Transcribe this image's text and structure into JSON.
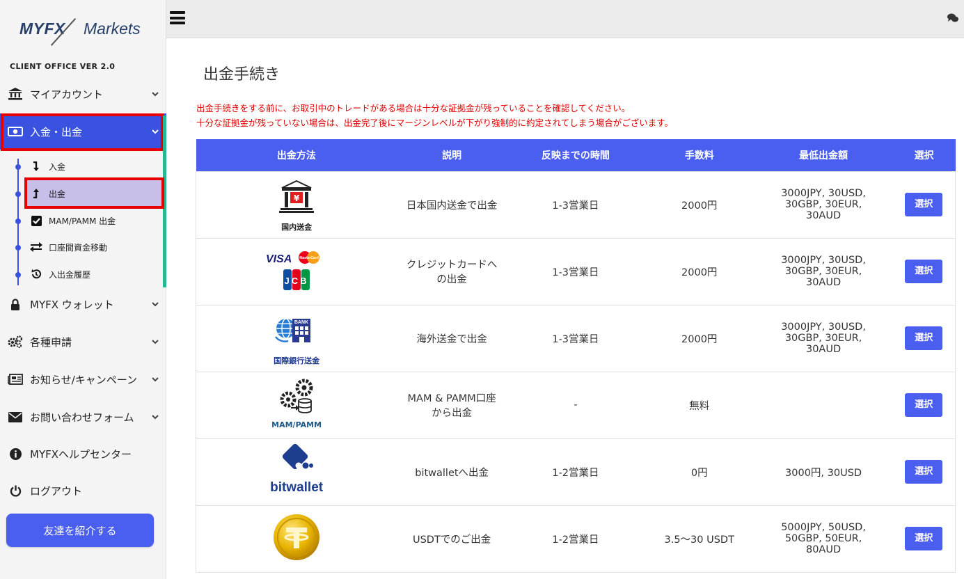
{
  "brand": {
    "logo_left": "MYFX",
    "logo_right": "Markets",
    "version_label": "CLIENT OFFICE VER 2.0"
  },
  "sidebar": {
    "items": [
      {
        "label": "マイアカウント",
        "icon": "bank-icon"
      },
      {
        "label": "入金・出金",
        "icon": "money-icon"
      },
      {
        "label": "MYFX ウォレット",
        "icon": "lock-icon"
      },
      {
        "label": "各種申請",
        "icon": "gears-icon"
      },
      {
        "label": "お知らせ/キャンペーン",
        "icon": "newspaper-icon"
      },
      {
        "label": "お問い合わせフォーム",
        "icon": "envelope-icon"
      },
      {
        "label": "MYFXヘルプセンター",
        "icon": "info-icon"
      },
      {
        "label": "ログアウト",
        "icon": "power-icon"
      }
    ],
    "sub_items": [
      {
        "label": "入金",
        "icon": "arrow-down-icon"
      },
      {
        "label": "出金",
        "icon": "arrow-up-icon"
      },
      {
        "label": "MAM/PAMM 出金",
        "icon": "checkbox-icon"
      },
      {
        "label": "口座間資金移動",
        "icon": "transfer-icon"
      },
      {
        "label": "入出金履歴",
        "icon": "history-icon"
      }
    ],
    "refer_button": "友達を紹介する"
  },
  "main": {
    "title": "出金手続き",
    "warning_lines": [
      "出金手続きをする前に、お取引中のトレードがある場合は十分な証拠金が残っていることを確認してください。",
      "十分な証拠金が残っていない場合は、出金完了後にマージンレベルが下がり強制的に約定されてしまう場合がございます。"
    ],
    "table": {
      "headers": [
        "出金方法",
        "説明",
        "反映までの時間",
        "手数料",
        "最低出金額",
        "選択"
      ],
      "rows": [
        {
          "method_caption": "国内送金",
          "yen": "¥",
          "description": "日本国内送金で出金",
          "time": "1-3営業日",
          "fee": "2000円",
          "minimum": "3000JPY, 30USD, 30GBP, 30EUR, 30AUD",
          "button": "選択"
        },
        {
          "method_caption": "VISA",
          "mc": "MasterCard",
          "jcb": "JCB",
          "description": "クレジットカードへの出金",
          "time": "1-3営業日",
          "fee": "2000円",
          "minimum": "3000JPY, 30USD, 30GBP, 30EUR, 30AUD",
          "button": "選択"
        },
        {
          "method_caption": "国際銀行送金",
          "bank": "BANK",
          "description": "海外送金で出金",
          "time": "1-3営業日",
          "fee": "2000円",
          "minimum": "3000JPY, 30USD, 30GBP, 30EUR, 30AUD",
          "button": "選択"
        },
        {
          "method_caption": "MAM/PAMM",
          "description": "MAM & PAMM口座から出金",
          "time": "-",
          "fee": "無料",
          "minimum": "",
          "button": "選択"
        },
        {
          "method_caption": "bitwallet",
          "description": "bitwalletへ出金",
          "time": "1-2営業日",
          "fee": "0円",
          "minimum": "3000円, 30USD",
          "button": "選択"
        },
        {
          "method_caption": "USDT",
          "description": "USDTでのご出金",
          "time": "1-2営業日",
          "fee": "3.5～30 USDT",
          "minimum": "5000JPY, 50USD, 50GBP, 50EUR, 80AUD",
          "button": "選択"
        }
      ]
    }
  },
  "colors": {
    "accent": "#4a5ff0",
    "highlight_red": "#e80000",
    "warning_text": "#e00000",
    "sub_active": "#c7bfe8",
    "teal_bar": "#27b893"
  }
}
